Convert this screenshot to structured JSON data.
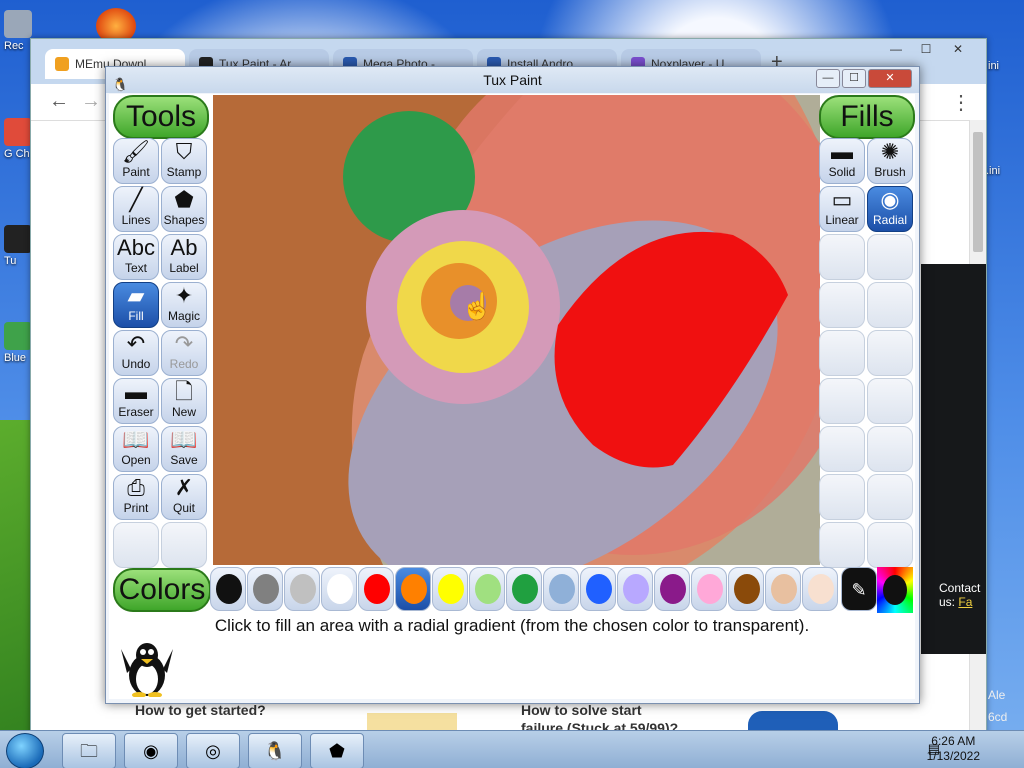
{
  "desktop": {
    "icons": [
      {
        "label": "Rec",
        "color": "#9aa7b8"
      },
      {
        "label": "G Ch",
        "color": "#e04b3a"
      },
      {
        "label": "Tu",
        "color": "#222222"
      },
      {
        "label": "Blue",
        "color": "#3fa24a"
      }
    ],
    "right_texts": [
      "ini",
      ".ini"
    ]
  },
  "browser": {
    "tabs": [
      {
        "label": "MEmu Downl",
        "icon": "memu-icon",
        "color": "#f0a020"
      },
      {
        "label": "Tux Paint - Ar",
        "icon": "tux-icon",
        "color": "#222222"
      },
      {
        "label": "Mega Photo -",
        "icon": "s-icon",
        "color": "#2a5ab0"
      },
      {
        "label": "Install Andro",
        "icon": "s-icon",
        "color": "#2a5ab0"
      },
      {
        "label": "Noxplayer - U",
        "icon": "nox-icon",
        "color": "#7b4fd0"
      }
    ],
    "new_tab": "+",
    "back": "←",
    "forward": "→",
    "menu": "⋮",
    "page_links": [
      "How to get started?",
      "How to solve start",
      "failure (Stuck at 59/99)?"
    ],
    "contact": "Contact us:",
    "contact_link": "Fa",
    "side_texts": [
      "Ale",
      "6cd"
    ]
  },
  "tuxpaint": {
    "title": "Tux Paint",
    "tools_header": "Tools",
    "fills_header": "Fills",
    "colors_header": "Colors",
    "tools": [
      {
        "label": "Paint",
        "glyph": "🖌"
      },
      {
        "label": "Stamp",
        "glyph": "⛉"
      },
      {
        "label": "Lines",
        "glyph": "╱"
      },
      {
        "label": "Shapes",
        "glyph": "⬟"
      },
      {
        "label": "Text",
        "glyph": "Abc"
      },
      {
        "label": "Label",
        "glyph": "Ab"
      },
      {
        "label": "Fill",
        "glyph": "▰"
      },
      {
        "label": "Magic",
        "glyph": "✦"
      },
      {
        "label": "Undo",
        "glyph": "↶"
      },
      {
        "label": "Redo",
        "glyph": "↷"
      },
      {
        "label": "Eraser",
        "glyph": "▬"
      },
      {
        "label": "New",
        "glyph": "🗋"
      },
      {
        "label": "Open",
        "glyph": "📖"
      },
      {
        "label": "Save",
        "glyph": "📖"
      },
      {
        "label": "Print",
        "glyph": "⎙"
      },
      {
        "label": "Quit",
        "glyph": "✗"
      }
    ],
    "selected_tool": "Fill",
    "disabled_tool": "Redo",
    "fills": [
      {
        "label": "Solid",
        "glyph": "▬"
      },
      {
        "label": "Brush",
        "glyph": "✺"
      },
      {
        "label": "Linear",
        "glyph": "▭"
      },
      {
        "label": "Radial",
        "glyph": "◉"
      }
    ],
    "selected_fill": "Radial",
    "palette": [
      "#111111",
      "#808080",
      "#c0c0c0",
      "#ffffff",
      "#ff0000",
      "#ff8000",
      "#ffff00",
      "#a0e080",
      "#20a040",
      "#8fb0d8",
      "#2060ff",
      "#b8a8ff",
      "#8a1a8a",
      "#ffa8d8",
      "#8a4a0a",
      "#e8c0a0",
      "#f8e0d0"
    ],
    "selected_color_index": 5,
    "tip": "Click to fill an area with a radial gradient (from the chosen color to transparent)."
  },
  "taskbar": {
    "apps": [
      {
        "name": "explorer",
        "glyph": "🗀"
      },
      {
        "name": "firefox",
        "glyph": "◉"
      },
      {
        "name": "chrome",
        "glyph": "◎"
      },
      {
        "name": "tuxpaint",
        "glyph": "🐧"
      },
      {
        "name": "memu",
        "glyph": "⬟"
      }
    ],
    "time": "6:26 AM",
    "date": "1/13/2022"
  }
}
